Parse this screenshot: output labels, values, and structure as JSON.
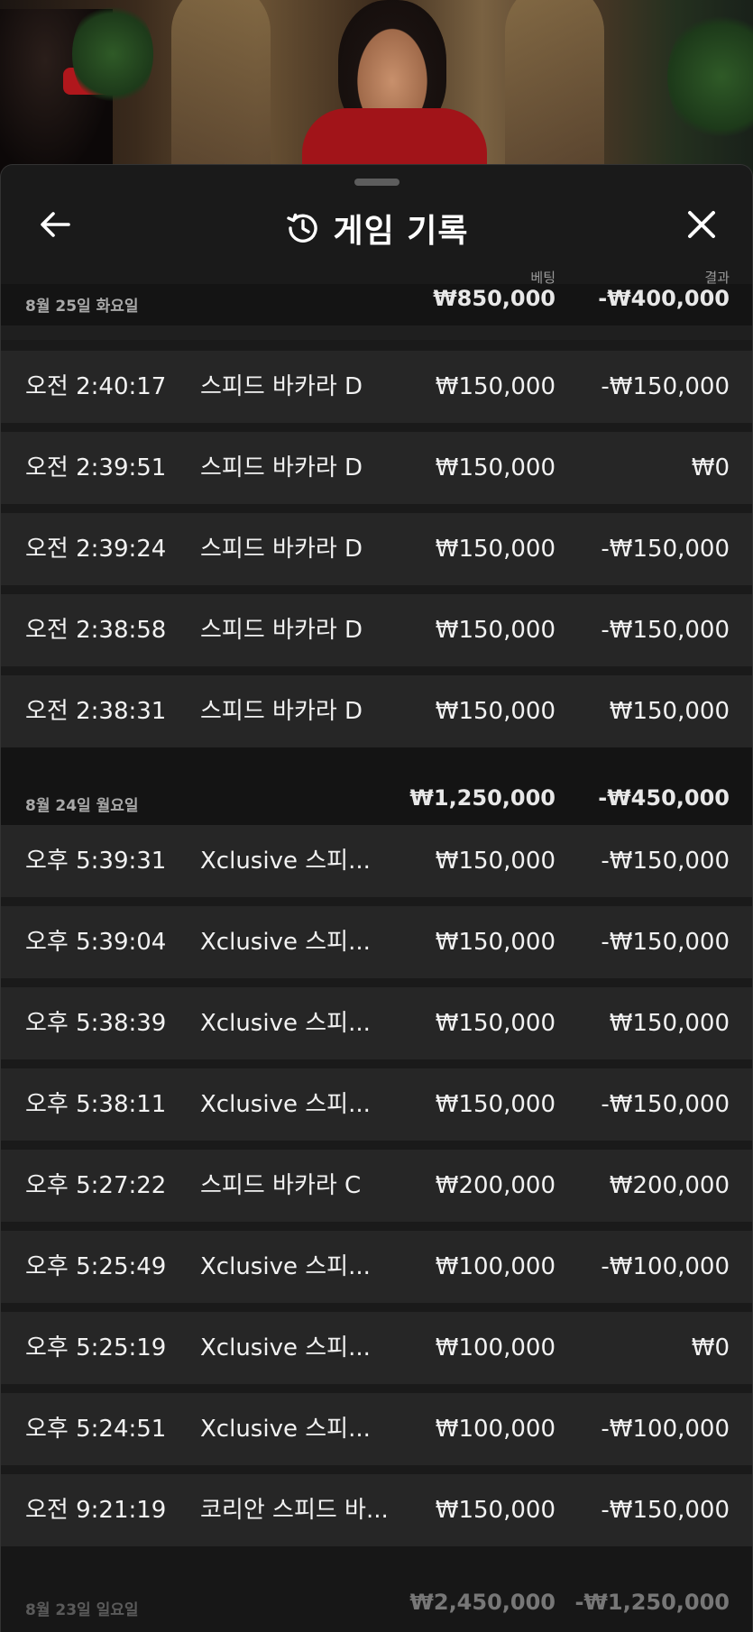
{
  "header": {
    "title": "게임 기록"
  },
  "columns": {
    "bet": "베팅",
    "result": "결과"
  },
  "groups": [
    {
      "date": "8월 25일 화요일",
      "total_bet": "₩850,000",
      "total_result": "-₩400,000",
      "rows": [
        {
          "time": "오전 2:40:17",
          "game": "스피드 바카라 D",
          "bet": "₩150,000",
          "result": "-₩150,000"
        },
        {
          "time": "오전 2:39:51",
          "game": "스피드 바카라 D",
          "bet": "₩150,000",
          "result": "₩0"
        },
        {
          "time": "오전 2:39:24",
          "game": "스피드 바카라 D",
          "bet": "₩150,000",
          "result": "-₩150,000"
        },
        {
          "time": "오전 2:38:58",
          "game": "스피드 바카라 D",
          "bet": "₩150,000",
          "result": "-₩150,000"
        },
        {
          "time": "오전 2:38:31",
          "game": "스피드 바카라 D",
          "bet": "₩150,000",
          "result": "₩150,000"
        }
      ]
    },
    {
      "date": "8월 24일 월요일",
      "total_bet": "₩1,250,000",
      "total_result": "-₩450,000",
      "rows": [
        {
          "time": "오후 5:39:31",
          "game": "Xclusive 스피...",
          "bet": "₩150,000",
          "result": "-₩150,000"
        },
        {
          "time": "오후 5:39:04",
          "game": "Xclusive 스피...",
          "bet": "₩150,000",
          "result": "-₩150,000"
        },
        {
          "time": "오후 5:38:39",
          "game": "Xclusive 스피...",
          "bet": "₩150,000",
          "result": "₩150,000"
        },
        {
          "time": "오후 5:38:11",
          "game": "Xclusive 스피...",
          "bet": "₩150,000",
          "result": "-₩150,000"
        },
        {
          "time": "오후 5:27:22",
          "game": "스피드 바카라 C",
          "bet": "₩200,000",
          "result": "₩200,000"
        },
        {
          "time": "오후 5:25:49",
          "game": "Xclusive 스피...",
          "bet": "₩100,000",
          "result": "-₩100,000"
        },
        {
          "time": "오후 5:25:19",
          "game": "Xclusive 스피...",
          "bet": "₩100,000",
          "result": "₩0"
        },
        {
          "time": "오후 5:24:51",
          "game": "Xclusive 스피...",
          "bet": "₩100,000",
          "result": "-₩100,000"
        },
        {
          "time": "오전 9:21:19",
          "game": "코리안 스피드 바...",
          "bet": "₩150,000",
          "result": "-₩150,000"
        }
      ]
    },
    {
      "date": "8월 23일 일요일",
      "total_bet": "₩2,450,000",
      "total_result": "-₩1,250,000",
      "rows": []
    }
  ]
}
